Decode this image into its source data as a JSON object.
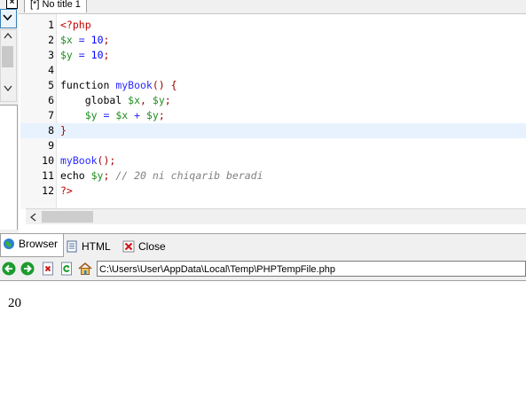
{
  "editor": {
    "tab_label": "[*] No title 1",
    "line_numbers": [
      "1",
      "2",
      "3",
      "4",
      "5",
      "6",
      "7",
      "8",
      "9",
      "10",
      "11",
      "12"
    ],
    "active_line": 8,
    "lines": [
      [
        {
          "t": "<?php",
          "c": "tag"
        }
      ],
      [
        {
          "t": "$x",
          "c": "var"
        },
        {
          "t": " = ",
          "c": "op"
        },
        {
          "t": "10",
          "c": "num"
        },
        {
          "t": ";",
          "c": "punct"
        }
      ],
      [
        {
          "t": "$y",
          "c": "var"
        },
        {
          "t": " = ",
          "c": "op"
        },
        {
          "t": "10",
          "c": "num"
        },
        {
          "t": ";",
          "c": "punct"
        }
      ],
      [],
      [
        {
          "t": "function ",
          "c": "kw"
        },
        {
          "t": "myBook",
          "c": "fn"
        },
        {
          "t": "() {",
          "c": "punct"
        }
      ],
      [
        {
          "t": "    global ",
          "c": "kw"
        },
        {
          "t": "$x",
          "c": "var"
        },
        {
          "t": ", ",
          "c": "punct"
        },
        {
          "t": "$y",
          "c": "var"
        },
        {
          "t": ";",
          "c": "punct"
        }
      ],
      [
        {
          "t": "    ",
          "c": "kw"
        },
        {
          "t": "$y",
          "c": "var"
        },
        {
          "t": " = ",
          "c": "op"
        },
        {
          "t": "$x",
          "c": "var"
        },
        {
          "t": " + ",
          "c": "op"
        },
        {
          "t": "$y",
          "c": "var"
        },
        {
          "t": ";",
          "c": "punct"
        }
      ],
      [
        {
          "t": "}",
          "c": "punct"
        }
      ],
      [],
      [
        {
          "t": "myBook",
          "c": "fn"
        },
        {
          "t": "();",
          "c": "punct"
        }
      ],
      [
        {
          "t": "echo ",
          "c": "kw"
        },
        {
          "t": "$y",
          "c": "var"
        },
        {
          "t": "; ",
          "c": "punct"
        },
        {
          "t": "// 20 ni chiqarib beradi",
          "c": "com"
        }
      ],
      [
        {
          "t": "?>",
          "c": "tag"
        }
      ]
    ]
  },
  "bottom_tabs": {
    "browser_label": "Browser",
    "html_label": "HTML",
    "close_label": "Close"
  },
  "browser": {
    "url": "C:\\Users\\User\\AppData\\Local\\Temp\\PHPTempFile.php",
    "output": "20"
  },
  "icons": {
    "browser_tab": "globe-icon",
    "html_tab": "document-icon",
    "close_tab": "close-icon",
    "back": "back-arrow-icon",
    "forward": "forward-arrow-icon",
    "stop": "stop-icon",
    "refresh": "refresh-icon",
    "home": "home-icon"
  },
  "colors": {
    "variable": "#1e8c1e",
    "number": "#0000ff",
    "function": "#2a2aff",
    "comment": "#808080",
    "php_tag": "#c00000",
    "active_line_bg": "#e8f2fe"
  }
}
